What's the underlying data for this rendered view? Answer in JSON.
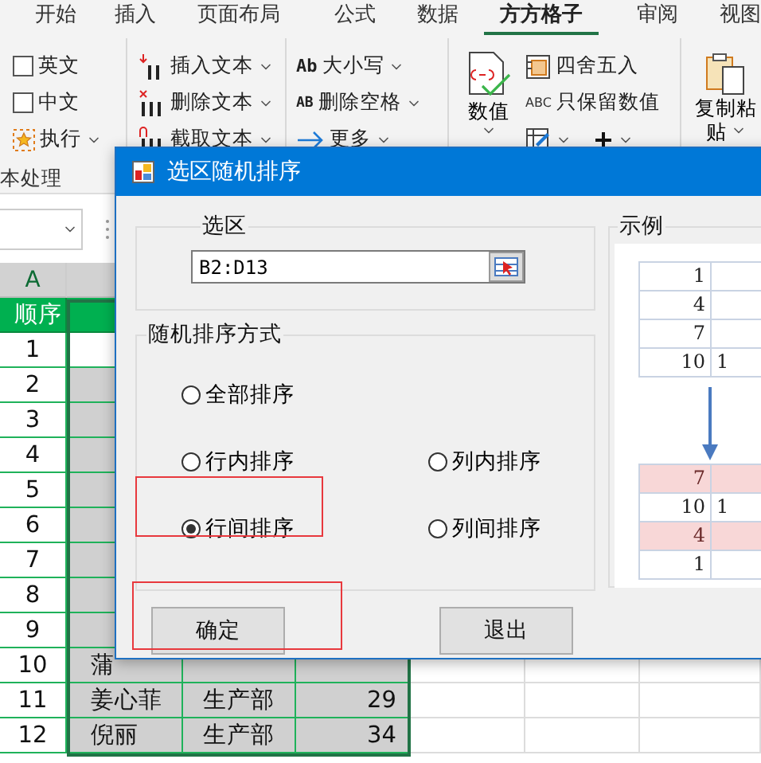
{
  "ribbon_tabs": [
    {
      "label": "开始",
      "selected": false
    },
    {
      "label": "插入",
      "selected": false
    },
    {
      "label": "页面布局",
      "selected": false
    },
    {
      "label": "公式",
      "selected": false
    },
    {
      "label": "数据",
      "selected": false
    },
    {
      "label": "方方格子",
      "selected": true
    },
    {
      "label": "审阅",
      "selected": false
    },
    {
      "label": "视图",
      "selected": false
    }
  ],
  "ribbon": {
    "language_options": [
      {
        "label": "英文",
        "checked": false
      },
      {
        "label": "中文",
        "checked": false
      }
    ],
    "execute": {
      "label": "执行"
    },
    "text_tools": [
      {
        "label": "插入文本",
        "kind": "insert"
      },
      {
        "label": "删除文本",
        "kind": "delete"
      },
      {
        "label": "截取文本",
        "kind": "extract"
      }
    ],
    "case_tools": [
      {
        "label": "大小写",
        "kind": "case",
        "icon_text": "Ab"
      },
      {
        "label": "删除空格",
        "kind": "space",
        "icon_text": "AB"
      },
      {
        "label": "更多",
        "kind": "more"
      }
    ],
    "number_button": {
      "label": "数值"
    },
    "number_tools": [
      {
        "label": "四舍五入",
        "kind": "round"
      },
      {
        "label": "只保留数值",
        "kind": "keep",
        "icon_text": "ABC"
      }
    ],
    "paste_button": {
      "label": "复制粘贴"
    },
    "group_label": "本处理"
  },
  "sheet": {
    "column_header": "A",
    "header_cell": "顺序",
    "rows": [
      {
        "number": "1",
        "active": true
      },
      {
        "number": "2",
        "active": false
      },
      {
        "number": "3",
        "active": false
      },
      {
        "number": "4",
        "active": false
      },
      {
        "number": "5",
        "active": false
      },
      {
        "number": "6",
        "active": false
      },
      {
        "number": "7",
        "active": false
      },
      {
        "number": "8",
        "active": false
      },
      {
        "number": "9",
        "active": false
      },
      {
        "number": "10",
        "active": false,
        "name": "蒲"
      },
      {
        "number": "11",
        "active": false,
        "name": "姜心菲",
        "dept": "生产部",
        "age": "29"
      },
      {
        "number": "12",
        "active": false,
        "name": "倪丽",
        "dept": "生产部",
        "age": "34"
      }
    ]
  },
  "dialog": {
    "title": "选区随机排序",
    "range_group": {
      "label": "选区",
      "value": "B2:D13"
    },
    "mode_group": {
      "label": "随机排序方式",
      "options": [
        {
          "label": "全部排序",
          "selected": false,
          "annotated": false
        },
        {
          "label": "行内排序",
          "selected": false,
          "annotated": false
        },
        {
          "label": "列内排序",
          "selected": false,
          "annotated": false
        },
        {
          "label": "行间排序",
          "selected": true,
          "annotated": true
        },
        {
          "label": "列间排序",
          "selected": false,
          "annotated": false
        }
      ]
    },
    "buttons": [
      {
        "label": "确定",
        "annotated": true
      },
      {
        "label": "退出",
        "annotated": false
      }
    ],
    "example": {
      "label": "示例",
      "before": [
        {
          "cells": [
            "1"
          ],
          "highlighted": false
        },
        {
          "cells": [
            "4"
          ],
          "highlighted": false
        },
        {
          "cells": [
            "7"
          ],
          "highlighted": false
        },
        {
          "cells": [
            "10",
            "1"
          ],
          "highlighted": false
        }
      ],
      "after": [
        {
          "cells": [
            "7"
          ],
          "highlighted": true
        },
        {
          "cells": [
            "10",
            "1"
          ],
          "highlighted": false
        },
        {
          "cells": [
            "4"
          ],
          "highlighted": true
        },
        {
          "cells": [
            "1"
          ],
          "highlighted": false
        }
      ]
    }
  }
}
